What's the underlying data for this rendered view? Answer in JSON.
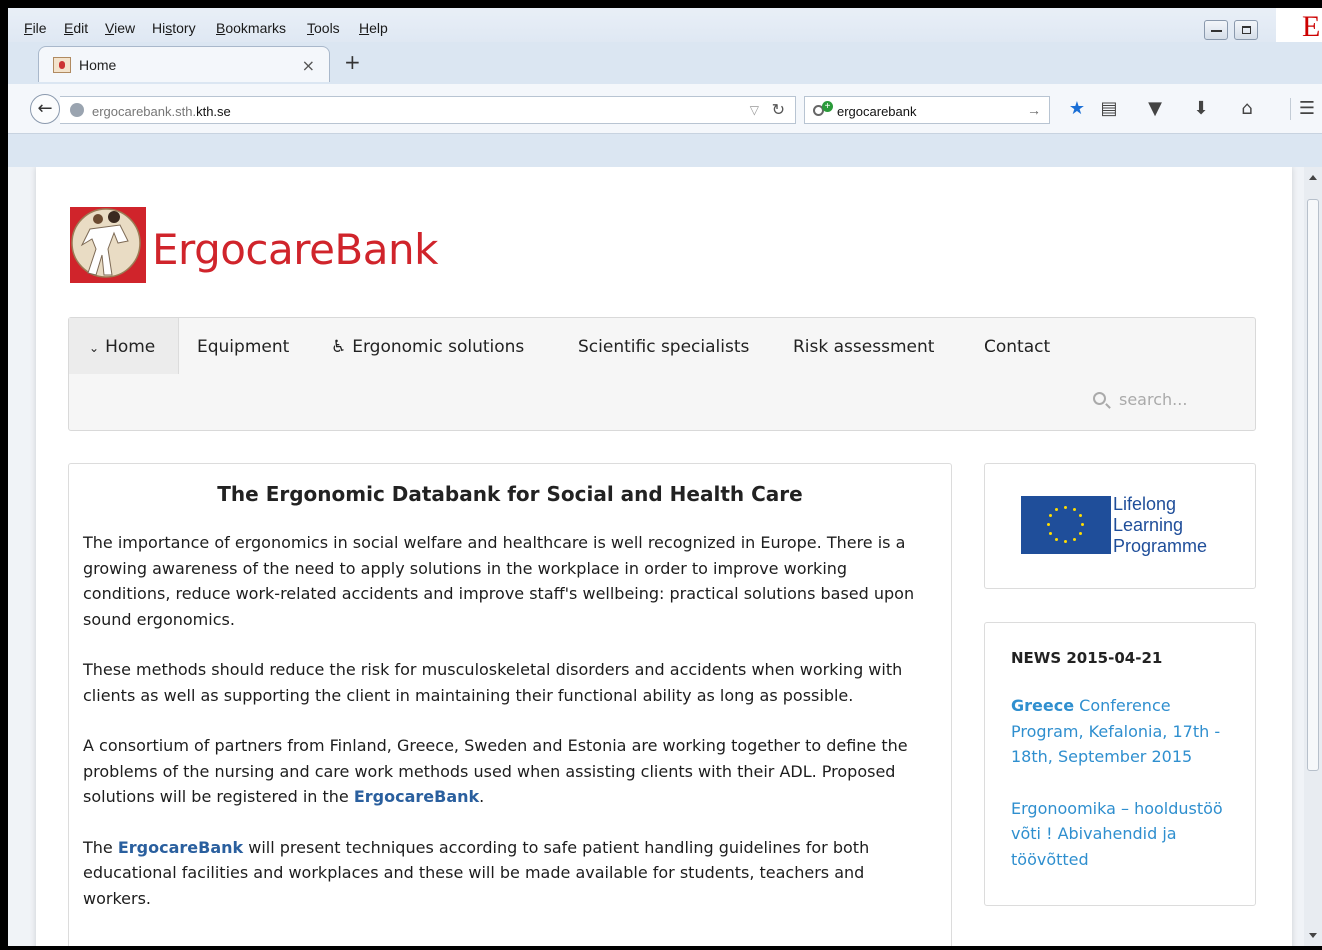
{
  "browser": {
    "menu": [
      {
        "label": "File",
        "underline": "F",
        "rest": "ile"
      },
      {
        "label": "Edit",
        "underline": "E",
        "rest": "dit"
      },
      {
        "label": "View",
        "underline": "V",
        "rest": "iew"
      },
      {
        "label": "History",
        "underline": "s",
        "pre": "Hi",
        "rest": "tory"
      },
      {
        "label": "Bookmarks",
        "underline": "B",
        "rest": "ookmarks"
      },
      {
        "label": "Tools",
        "underline": "T",
        "rest": "ools"
      },
      {
        "label": "Help",
        "underline": "H",
        "rest": "elp"
      }
    ],
    "cut_letter": "E",
    "tab": {
      "title": "Home",
      "close": "×",
      "new_tab": "+"
    },
    "url": {
      "host_prefix": "ergocarebank.sth.",
      "host_domain": "kth.se"
    },
    "search": {
      "value": "ergocarebank"
    }
  },
  "site": {
    "title": "ErgocareBank",
    "nav": {
      "home": "Home",
      "equipment": "Equipment",
      "ergonomic_solutions": "Ergonomic solutions",
      "scientific_specialists": "Scientific specialists",
      "risk_assessment": "Risk assessment",
      "contact": "Contact",
      "search_placeholder": "search..."
    },
    "article": {
      "title": "The Ergonomic Databank for Social and Health Care",
      "p1": "The importance of ergonomics in social welfare and healthcare is well recognized in Europe. There is a growing awareness of the need to apply solutions in the workplace in order to improve working conditions, reduce work-related accidents and improve staff's wellbeing: practical solutions based upon sound ergonomics.",
      "p2": "These methods should reduce the risk for musculoskeletal disorders and accidents when working with clients as well as supporting the client in maintaining their functional ability as long as possible.",
      "p3_before": "A consortium of partners from Finland, Greece, Sweden and Estonia are working together to define the problems of the nursing and care work methods used when assisting clients with their ADL. Proposed solutions will be registered in the ",
      "p3_link": "ErgocareBank",
      "p3_after": ".",
      "p4_before": "The ",
      "p4_link": "ErgocareBank",
      "p4_after": " will present techniques according to safe patient handling guidelines for both educational facilities and workplaces and these will be made available for students, teachers and workers."
    },
    "sidebar": {
      "programme_line1": "Lifelong",
      "programme_line2": "Learning",
      "programme_line3": "Programme",
      "news_heading": "NEWS 2015-04-21",
      "news1_strong": "Greece",
      "news1_rest": " Conference Program, Kefalonia, 17th - 18th, September 2015",
      "news2": "Ergonoomika – hooldustöö võti ! Abivahendid ja töövõtted"
    }
  },
  "colors": {
    "brand_red": "#d0242b",
    "link_blue": "#2a5f9e",
    "news_blue": "#2f8fcf",
    "eu_blue": "#1f4e9a"
  }
}
